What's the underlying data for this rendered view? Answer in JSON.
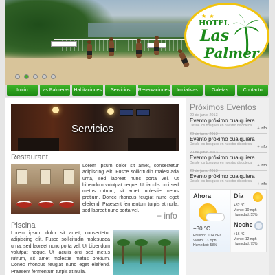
{
  "logo": {
    "stars": "★ ★",
    "hotel": "HOTEL",
    "name_line1": "Las",
    "name_line2": "Palmeras"
  },
  "nav": [
    "Inicio",
    "Las Palmeras",
    "Habitaciones",
    "Servicios",
    "Reservaciones",
    "Iniciativas",
    "Galeías",
    "Contacto"
  ],
  "slider": {
    "dots": 5,
    "active": 1
  },
  "servicios": {
    "title": "Servicios"
  },
  "restaurant": {
    "title": "Restaurant",
    "text": "Lorem ipsum dolor sit amet, consectetur adipiscing elit. Fusce sollicitudin malesuada urna, sed laoreet nunc porta vel. Ut bibendum volutpat neque. Ut iaculis orci sed metus rutrum, sit amet molestie metus pretium. Donec rhoncus feugiat nunc eget eleifend. Praesent fermentum turpis at nulla, sed laoreet nunc porta vel.",
    "more": "+ info"
  },
  "piscina": {
    "title": "Piscina",
    "text": "Lorem ipsum dolor sit amet, consectetur adipiscing elit. Fusce sollicitudin malesuada urna, sed laoreet nunc porta vel. Ut bibendum volutpat neque. Ut iaculis orci sed metus rutrum, sit amet molestie metus pretium. Donec rhoncus feugiat nunc eget eleifend. Praesent fermentum turpis at nulla."
  },
  "events": {
    "title": "Próximos Eventos",
    "items": [
      {
        "date": "20 de junio 2013",
        "title": "Evento próximo cualquiera",
        "desc": "Desde los bosques en nuestro discoteca",
        "info_prefix": "+",
        "info": "info"
      },
      {
        "date": "20 de junio 2013",
        "title": "Evento próximo cualquiera",
        "desc": "Desde los bosques en nuestro discoteca",
        "info_prefix": "+",
        "info": "info"
      },
      {
        "date": "20 de junio 2013",
        "title": "Evento próximo cualquiera",
        "desc": "Desde los bosques en nuestro discoteca",
        "info_prefix": "+",
        "info": "info"
      },
      {
        "date": "20 de junio 2013",
        "title": "Evento próximo cualquiera",
        "desc": "Desde los bosques en nuestro discoteca",
        "info_prefix": "+",
        "info": "info"
      }
    ]
  },
  "weather": {
    "now": {
      "label": "Ahora",
      "temp": "+30 °C",
      "pressure": "Presión: 1014 hPa",
      "wind": "Viento: 13 mph",
      "humidity": "Humedad: 58%"
    },
    "day": {
      "label": "Día",
      "temp": "+32 °C",
      "wind": "Viento: 10 mph",
      "humidity": "Humedad: 55%"
    },
    "night": {
      "label": "Noche",
      "temp": "+16 °C",
      "wind": "Viento: 12 mph",
      "humidity": "Humedad: 75%"
    }
  }
}
